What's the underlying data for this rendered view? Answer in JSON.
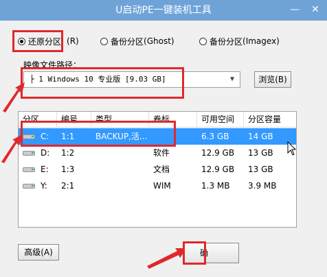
{
  "window": {
    "title": "U启动PE一键装机工具",
    "minimize": "—",
    "close": "✕"
  },
  "modes": [
    {
      "label": "还原分区",
      "key": "(R)",
      "selected": true
    },
    {
      "label": "备份分区",
      "key": "(Ghost)",
      "selected": false
    },
    {
      "label": "备份分区",
      "key": "(Imagex)",
      "selected": false
    }
  ],
  "image_path": {
    "label": "映像文件路径：",
    "value": "├ 1 Windows 10 专业版 [9.03 GB]",
    "browse_label": "浏览(B)"
  },
  "table": {
    "columns": [
      "分区",
      "编号",
      "类型",
      "卷标",
      "可用空间",
      "分区容量"
    ],
    "rows": [
      {
        "drive": "C:",
        "number": "1:1",
        "type": "BACKUP,活...",
        "label": "",
        "free": "6.3 GB",
        "size": "14 GB",
        "selected": true
      },
      {
        "drive": "D:",
        "number": "1:2",
        "type": "",
        "label": "软件",
        "free": "12.9 GB",
        "size": "13 GB",
        "selected": false
      },
      {
        "drive": "E:",
        "number": "1:3",
        "type": "",
        "label": "文档",
        "free": "12.9 GB",
        "size": "13 GB",
        "selected": false
      },
      {
        "drive": "Y:",
        "number": "2:1",
        "type": "",
        "label": "WIM",
        "free": "1.3 MB",
        "size": "3.9 MB",
        "selected": false
      }
    ]
  },
  "buttons": {
    "advanced": "高级(A)",
    "ok": "确"
  },
  "colors": {
    "highlight": "#e0282b",
    "selection": "#3399ff",
    "titlebar": "#6fa3d8"
  }
}
